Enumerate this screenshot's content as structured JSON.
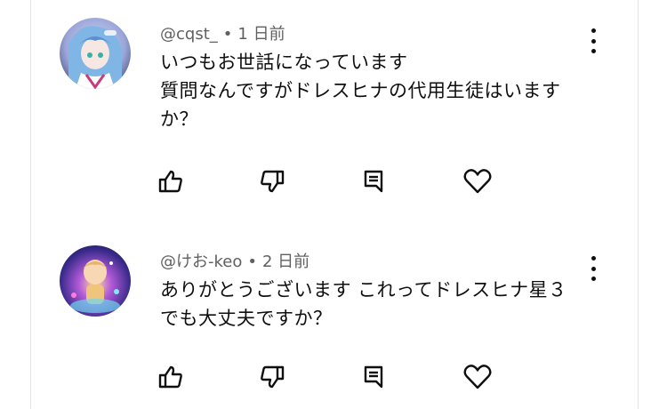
{
  "comments": [
    {
      "author": "@cqst_",
      "separator": "•",
      "time": "1 日前",
      "lines": [
        "いつもお世話になっています",
        "質問なんですがドレスヒナの代用生徒はいます",
        "か？"
      ],
      "actions": [
        "like-icon",
        "dislike-icon",
        "reply-icon",
        "heart-icon"
      ]
    },
    {
      "author": "@けお-keo",
      "separator": "•",
      "time": "2 日前",
      "lines": [
        "ありがとうございます これってドレスヒナ星３",
        "でも大丈夫ですか？"
      ],
      "actions": [
        "like-icon",
        "dislike-icon",
        "reply-icon",
        "heart-icon"
      ]
    }
  ],
  "colors": {
    "text": "#0f0f0f",
    "meta": "#606060",
    "icon": "#0f0f0f",
    "border": "#e4e4e4"
  }
}
